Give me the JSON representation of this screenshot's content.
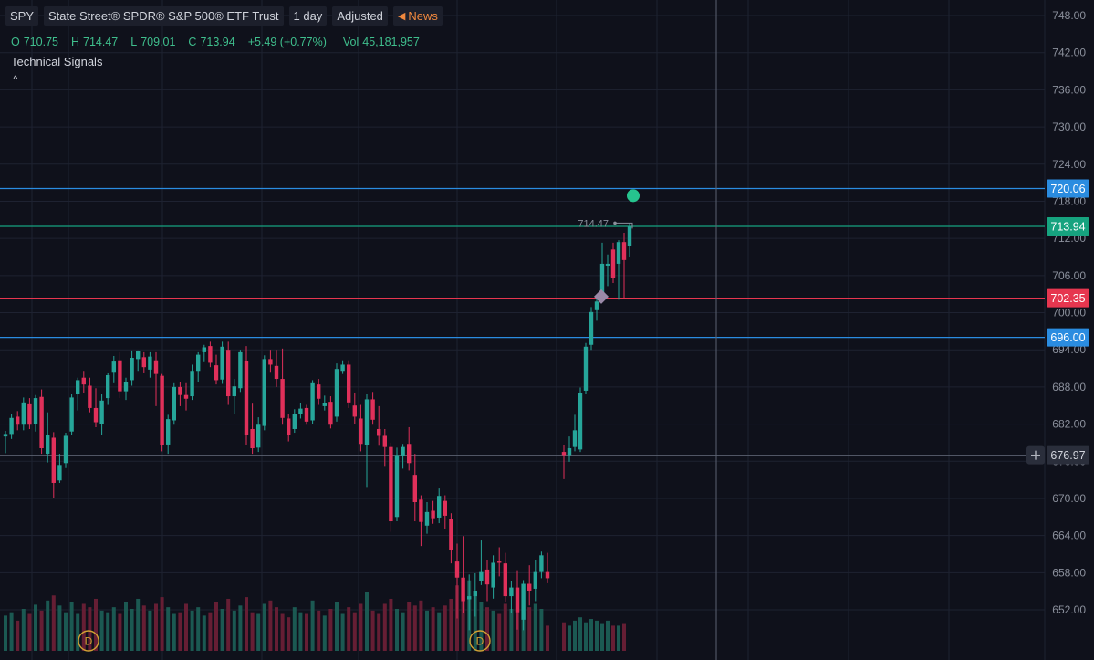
{
  "header": {
    "symbol": "SPY",
    "name": "State Street® SPDR® S&P 500® ETF Trust",
    "interval": "1 day",
    "adjusted": "Adjusted",
    "news": "News"
  },
  "ohlc": {
    "o_label": "O",
    "o": "710.75",
    "h_label": "H",
    "h": "714.47",
    "l_label": "L",
    "l": "709.01",
    "c_label": "C",
    "c": "713.94",
    "change": "+5.49 (+0.77%)",
    "vol_label": "Vol",
    "vol": "45,181,957"
  },
  "panel": {
    "signals_label": "Technical Signals",
    "collapse_glyph": "^"
  },
  "colors": {
    "up": "#26a69a",
    "down": "#e0305a",
    "bg": "#0f111b",
    "grid": "#1e2231"
  },
  "chart_data": {
    "type": "candlestick",
    "ylim": [
      648,
      750
    ],
    "yticks": [
      652,
      658,
      664,
      670,
      676,
      682,
      688,
      694,
      700,
      706,
      712,
      718,
      724,
      730,
      736,
      742,
      748
    ],
    "ytick_labels": [
      "652.00",
      "658.00",
      "664.00",
      "670.00",
      "676.00",
      "682.00",
      "688.00",
      "694.00",
      "700.00",
      "706.00",
      "712.00",
      "718.00",
      "724.00",
      "730.00",
      "736.00",
      "742.00",
      "748.00"
    ],
    "candles": [
      [
        680.0,
        680.9,
        677.3,
        680.4
      ],
      [
        680.4,
        683.6,
        679.6,
        683.0
      ],
      [
        683.2,
        684.1,
        681.0,
        681.9
      ],
      [
        681.9,
        686.3,
        681.0,
        685.5
      ],
      [
        685.2,
        686.2,
        681.2,
        681.9
      ],
      [
        682.0,
        686.7,
        680.8,
        686.2
      ],
      [
        686.4,
        687.6,
        677.2,
        678.1
      ],
      [
        677.2,
        683.9,
        675.8,
        680.2
      ],
      [
        679.8,
        680.7,
        670.1,
        672.5
      ],
      [
        672.9,
        677.2,
        672.5,
        675.4
      ],
      [
        675.7,
        680.6,
        674.9,
        680.1
      ],
      [
        680.8,
        686.8,
        680.3,
        686.3
      ],
      [
        686.8,
        689.5,
        684.2,
        689.1
      ],
      [
        689.5,
        690.6,
        687.1,
        688.4
      ],
      [
        688.2,
        689.5,
        683.9,
        684.6
      ],
      [
        684.6,
        687.8,
        681.5,
        682.3
      ],
      [
        682.0,
        686.8,
        680.3,
        685.8
      ],
      [
        686.2,
        690.2,
        685.1,
        689.9
      ],
      [
        690.3,
        693.0,
        688.6,
        692.1
      ],
      [
        692.3,
        693.6,
        686.2,
        687.3
      ],
      [
        687.3,
        689.5,
        685.9,
        688.8
      ],
      [
        689.1,
        693.9,
        688.2,
        692.7
      ],
      [
        692.5,
        693.9,
        690.6,
        693.8
      ],
      [
        692.8,
        693.6,
        690.2,
        691.2
      ],
      [
        690.8,
        693.6,
        689.5,
        692.9
      ],
      [
        692.3,
        693.6,
        684.9,
        690.1
      ],
      [
        689.8,
        690.1,
        677.6,
        678.6
      ],
      [
        678.7,
        683.5,
        677.2,
        682.8
      ],
      [
        682.6,
        688.6,
        681.9,
        688.0
      ],
      [
        688.0,
        688.8,
        684.9,
        686.7
      ],
      [
        686.7,
        688.6,
        684.2,
        686.1
      ],
      [
        686.5,
        691.6,
        685.9,
        690.6
      ],
      [
        690.6,
        693.6,
        688.8,
        693.2
      ],
      [
        693.6,
        694.8,
        692.0,
        694.4
      ],
      [
        694.6,
        695.3,
        691.2,
        691.9
      ],
      [
        691.5,
        693.2,
        688.4,
        689.1
      ],
      [
        689.2,
        695.3,
        688.5,
        694.5
      ],
      [
        694.0,
        695.3,
        685.1,
        686.5
      ],
      [
        686.5,
        689.3,
        683.7,
        688.1
      ],
      [
        687.8,
        694.0,
        687.2,
        693.6
      ],
      [
        692.2,
        694.6,
        678.7,
        680.3
      ],
      [
        681.2,
        685.3,
        677.2,
        678.1
      ],
      [
        678.2,
        683.1,
        677.5,
        681.9
      ],
      [
        681.7,
        693.1,
        681.0,
        692.5
      ],
      [
        692.5,
        694.0,
        690.3,
        691.6
      ],
      [
        691.4,
        694.0,
        688.0,
        689.3
      ],
      [
        689.3,
        694.2,
        681.9,
        683.0
      ],
      [
        682.9,
        683.6,
        679.2,
        680.3
      ],
      [
        681.2,
        684.4,
        680.6,
        683.7
      ],
      [
        683.7,
        685.4,
        682.9,
        684.5
      ],
      [
        684.6,
        685.1,
        681.9,
        682.4
      ],
      [
        682.6,
        689.1,
        682.0,
        688.6
      ],
      [
        688.4,
        689.3,
        685.1,
        686.1
      ],
      [
        684.9,
        686.6,
        684.2,
        685.4
      ],
      [
        685.6,
        686.5,
        681.3,
        681.9
      ],
      [
        683.2,
        691.8,
        682.4,
        690.9
      ],
      [
        690.6,
        692.3,
        690.1,
        691.6
      ],
      [
        691.6,
        692.3,
        684.6,
        685.5
      ],
      [
        685.0,
        687.1,
        682.0,
        683.2
      ],
      [
        682.9,
        685.1,
        677.6,
        678.8
      ],
      [
        678.6,
        686.8,
        671.7,
        686.0
      ],
      [
        686.0,
        687.2,
        681.9,
        682.7
      ],
      [
        681.2,
        684.9,
        678.5,
        680.1
      ],
      [
        680.1,
        681.2,
        675.1,
        678.3
      ],
      [
        678.3,
        679.0,
        664.6,
        666.3
      ],
      [
        667.0,
        678.2,
        666.3,
        677.0
      ],
      [
        676.9,
        678.8,
        674.8,
        678.3
      ],
      [
        678.8,
        681.5,
        674.5,
        675.7
      ],
      [
        673.8,
        677.2,
        666.3,
        669.4
      ],
      [
        669.8,
        670.5,
        662.3,
        666.2
      ],
      [
        665.6,
        669.4,
        664.3,
        667.8
      ],
      [
        668.0,
        669.6,
        665.9,
        666.8
      ],
      [
        666.9,
        671.6,
        666.0,
        670.4
      ],
      [
        669.6,
        670.5,
        665.1,
        667.2
      ],
      [
        666.7,
        667.6,
        659.5,
        661.6
      ],
      [
        659.8,
        662.7,
        650.6,
        657.2
      ],
      [
        657.2,
        663.9,
        651.5,
        653.4
      ],
      [
        653.7,
        657.7,
        648.7,
        654.2
      ],
      [
        654.2,
        657.9,
        650.9,
        655.1
      ],
      [
        656.6,
        663.2,
        656.0,
        658.1
      ],
      [
        658.5,
        660.1,
        653.4,
        656.1
      ],
      [
        655.6,
        660.8,
        653.8,
        659.6
      ],
      [
        659.8,
        662.1,
        657.4,
        659.6
      ],
      [
        659.5,
        661.2,
        653.2,
        654.2
      ],
      [
        654.2,
        656.7,
        651.5,
        655.6
      ],
      [
        655.6,
        658.4,
        648.8,
        651.6
      ],
      [
        650.4,
        656.8,
        648.7,
        656.2
      ],
      [
        656.2,
        659.2,
        652.7,
        655.1
      ],
      [
        655.4,
        660.1,
        653.4,
        658.1
      ],
      [
        658.1,
        661.4,
        657.1,
        660.8
      ],
      [
        658.1,
        661.2,
        656.3,
        657.1
      ],
      [
        677.5,
        678.7,
        673.1,
        677.0
      ],
      [
        677.0,
        680.0,
        675.9,
        678.1
      ],
      [
        678.3,
        683.5,
        677.6,
        681.0
      ],
      [
        677.9,
        687.9,
        677.5,
        687.0
      ],
      [
        687.4,
        695.1,
        686.8,
        694.5
      ],
      [
        694.8,
        700.9,
        694.0,
        700.1
      ],
      [
        700.4,
        702.5,
        698.7,
        701.8
      ],
      [
        703.0,
        711.3,
        702.5,
        707.9
      ],
      [
        707.6,
        709.4,
        704.3,
        707.9
      ],
      [
        710.2,
        711.3,
        704.8,
        705.6
      ],
      [
        707.9,
        711.7,
        702.1,
        711.4
      ],
      [
        711.4,
        712.9,
        702.4,
        708.5
      ],
      [
        710.8,
        714.5,
        709.0,
        713.9
      ]
    ],
    "volumes": [
      42,
      46,
      36,
      50,
      44,
      55,
      48,
      60,
      66,
      54,
      46,
      58,
      44,
      56,
      52,
      62,
      48,
      46,
      52,
      44,
      58,
      50,
      62,
      54,
      48,
      56,
      64,
      52,
      44,
      46,
      56,
      48,
      52,
      42,
      46,
      58,
      50,
      62,
      48,
      54,
      64,
      46,
      44,
      56,
      60,
      52,
      44,
      40,
      52,
      46,
      44,
      60,
      48,
      42,
      50,
      58,
      44,
      52,
      46,
      56,
      70,
      48,
      44,
      56,
      62,
      50,
      46,
      58,
      54,
      60,
      48,
      52,
      46,
      54,
      62,
      78,
      68,
      84,
      66,
      58,
      52,
      48,
      44,
      56,
      50,
      58,
      46,
      52,
      56,
      50,
      30,
      34,
      30,
      36,
      40,
      34,
      38,
      36,
      32,
      36,
      30,
      30,
      32
    ],
    "markers": {
      "event_labels": [
        "D",
        "D"
      ],
      "swing_high_label": "714.47"
    },
    "levels": [
      {
        "value": 720.06,
        "label": "720.06",
        "color": "#2a8ce0"
      },
      {
        "value": 713.94,
        "label": "713.94",
        "color": "#16a37f"
      },
      {
        "value": 702.35,
        "label": "702.35",
        "color": "#e6364f"
      },
      {
        "value": 696.0,
        "label": "696.00",
        "color": "#2a8ce0"
      }
    ],
    "crosshair": {
      "value": 676.97,
      "label": "676.97"
    }
  }
}
